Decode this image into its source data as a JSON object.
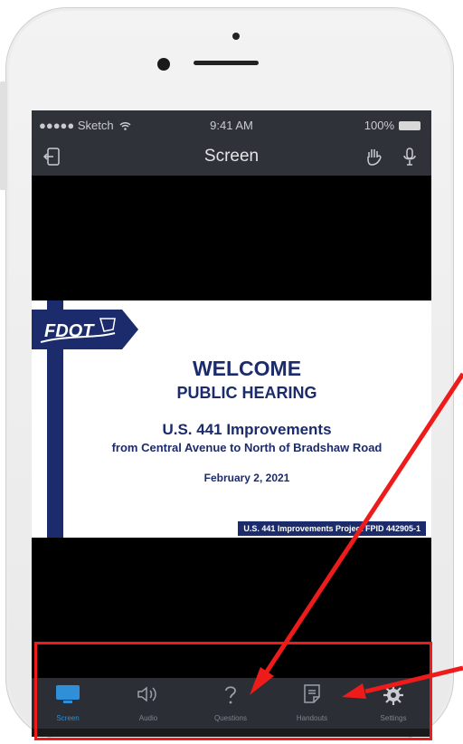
{
  "status_bar": {
    "carrier": "●●●●● Sketch",
    "time": "9:41 AM",
    "battery": "100%"
  },
  "nav": {
    "title": "Screen"
  },
  "slide": {
    "logo_text": "FDOT",
    "welcome": "WELCOME",
    "public_hearing": "PUBLIC HEARING",
    "project": "U.S. 441 Improvements",
    "limits": "from Central Avenue to North of Bradshaw Road",
    "date": "February 2, 2021",
    "footer": "U.S. 441 Improvements Project FPID 442905-1"
  },
  "tabs": [
    {
      "label": "Screen",
      "icon": "monitor-icon",
      "active": true
    },
    {
      "label": "Audio",
      "icon": "speaker-icon",
      "active": false
    },
    {
      "label": "Questions",
      "icon": "question-icon",
      "active": false
    },
    {
      "label": "Handouts",
      "icon": "document-icon",
      "active": false
    },
    {
      "label": "Settings",
      "icon": "gear-icon",
      "active": false
    }
  ],
  "colors": {
    "accent": "#2f8fd8",
    "annotation_red": "#ee1b1b",
    "fdot_navy": "#1b2b6b",
    "bar_dark": "#2f3238"
  }
}
